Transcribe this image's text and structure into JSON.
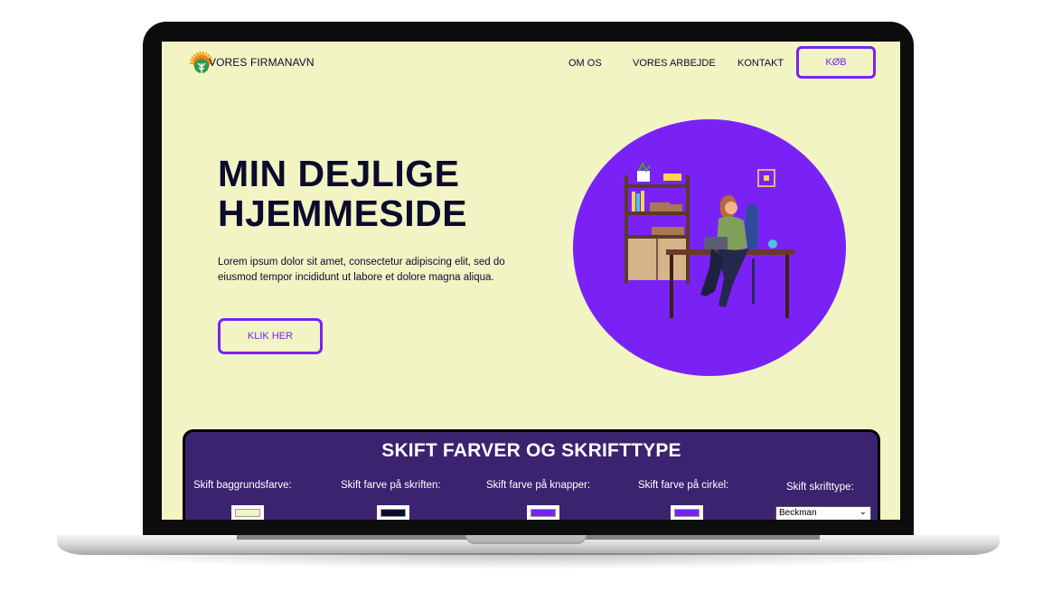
{
  "colors": {
    "background": "#f2f4c3",
    "text": "#0b0b2e",
    "accent": "#7a22f5",
    "circle": "#7a22f5",
    "panel": "#3b2370"
  },
  "nav": {
    "brand": "VORES FIRMANAVN",
    "logo_icon": "sun-tree-logo-icon",
    "links": [
      "OM OS",
      "VORES ARBEJDE",
      "KONTAKT"
    ],
    "buy_label": "KØB"
  },
  "hero": {
    "title_line1": "MIN DEJLIGE",
    "title_line2": "HJEMMESIDE",
    "text": "Lorem ipsum dolor sit amet, consectetur adipiscing elit, sed do eiusmod tempor incididunt ut labore et dolore magna aliqua.",
    "button_label": "KLIK HER",
    "illustration": "woman-at-desk-illustration"
  },
  "panel": {
    "title": "SKIFT FARVER OG SKRIFTTYPE",
    "labels": {
      "background": "Skift baggrundsfarve:",
      "text": "Skift farve på skriften:",
      "buttons": "Skift farve på knapper:",
      "circle": "Skift farve på cirkel:",
      "font": "Skift skrifttype:"
    },
    "swatches": {
      "background": "#f2f4c3",
      "text": "#0b0b2e",
      "buttons": "#7a22f5",
      "circle": "#7a22f5"
    },
    "font_selected": "Beckman"
  }
}
